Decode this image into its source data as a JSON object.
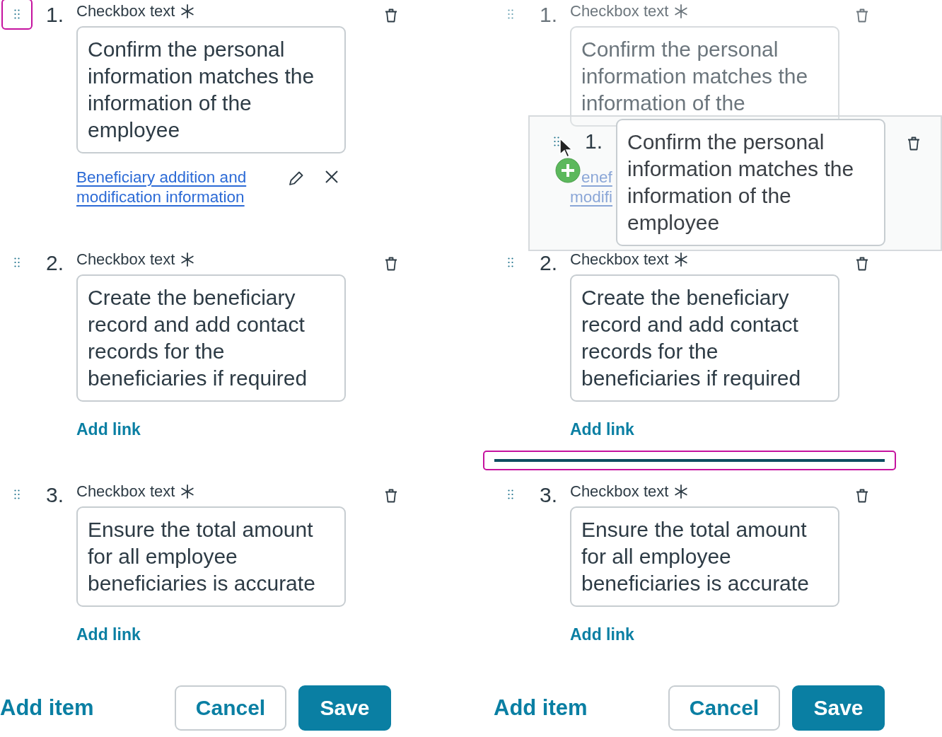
{
  "panels": [
    {
      "dragging": false,
      "items": [
        {
          "number": "1.",
          "label": "Checkbox text",
          "required": true,
          "text": "Confirm the personal information matches the information of the employee",
          "handle_focused": true,
          "ghost": false,
          "drop_indicator_after": false,
          "link": {
            "text": "Beneficiary addition and modification information"
          }
        },
        {
          "number": "2.",
          "label": "Checkbox text",
          "required": true,
          "text": "Create the beneficiary record and add contact records for the beneficiaries if required",
          "handle_focused": false,
          "ghost": false,
          "drop_indicator_after": false,
          "add_link": "Add link"
        },
        {
          "number": "3.",
          "label": "Checkbox text",
          "required": true,
          "text": "Ensure the total amount for all employee beneficiaries is accurate",
          "handle_focused": false,
          "ghost": false,
          "drop_indicator_after": false,
          "add_link": "Add link"
        }
      ],
      "add_item": "Add item",
      "buttons": [
        {
          "label": "Cancel",
          "kind": "secondary"
        },
        {
          "label": "Save",
          "kind": "primary"
        }
      ]
    },
    {
      "dragging": true,
      "items": [
        {
          "number": "1.",
          "label": "Checkbox text",
          "required": true,
          "text": "Confirm the personal information matches the information of the",
          "handle_focused": false,
          "ghost": true,
          "drop_indicator_after": false,
          "link_fragments": [
            "enef",
            "modifi"
          ]
        },
        {
          "number": "2.",
          "label": "Checkbox text",
          "required": true,
          "text": "Create the beneficiary record and add contact records for the beneficiaries if required",
          "handle_focused": false,
          "ghost": false,
          "drop_indicator_after": true,
          "add_link": "Add link"
        },
        {
          "number": "3.",
          "label": "Checkbox text",
          "required": true,
          "text": "Ensure the total amount for all employee beneficiaries is accurate",
          "handle_focused": false,
          "ghost": false,
          "drop_indicator_after": false,
          "add_link": "Add link"
        }
      ],
      "drag_preview": {
        "number": "1.",
        "text": "Confirm the personal information matches the information of the employee"
      },
      "add_item": "Add item",
      "buttons": [
        {
          "label": "Cancel",
          "kind": "secondary"
        },
        {
          "label": "Save",
          "kind": "primary"
        }
      ]
    }
  ]
}
